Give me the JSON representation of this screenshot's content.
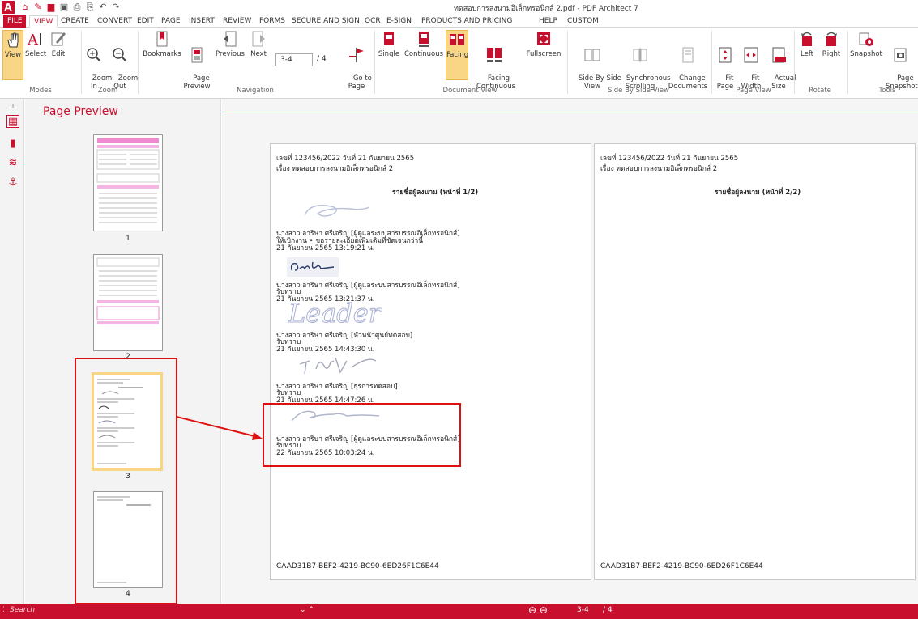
{
  "window": {
    "title": "ทดสอบการลงนามอิเล็กทรอนิกส์ 2.pdf   -   PDF Architect 7",
    "logo": "A"
  },
  "quick_access": [
    "home-icon",
    "pen-icon",
    "open-icon",
    "save-icon",
    "print-icon",
    "print-preview-icon",
    "undo-icon",
    "redo-icon"
  ],
  "tabs": [
    "FILE",
    "VIEW",
    "CREATE",
    "CONVERT",
    "EDIT",
    "PAGE",
    "INSERT",
    "REVIEW",
    "FORMS",
    "SECURE AND SIGN",
    "OCR",
    "E-SIGN",
    "PRODUCTS AND PRICING",
    "HELP",
    "CUSTOM"
  ],
  "active_tab": "VIEW",
  "ribbon": {
    "view": "View",
    "select": "Select",
    "edit": "Edit",
    "zoom_in": "Zoom\nIn",
    "zoom_out": "Zoom\nOut",
    "bookmarks": "Bookmarks",
    "page_preview": "Page\nPreview",
    "previous": "Previous",
    "next": "Next",
    "page_field": "3-4",
    "page_total": "/  4",
    "go_to_page": "Go to\nPage",
    "single": "Single",
    "continuous": "Continuous",
    "facing": "Facing",
    "facing_continuous": "Facing\nContinuous",
    "fullscreen": "Fullscreen",
    "side_by_side": "Side By Side\nView",
    "sync_scroll": "Synchronous\nScrolling",
    "change_docs": "Change\nDocuments",
    "fit_page": "Fit\nPage",
    "fit_width": "Fit\nWidth",
    "actual_size": "Actual\nSize",
    "left": "Left",
    "right": "Right",
    "snapshot": "Snapshot",
    "page_snapshot": "Page\nSnapshot",
    "groups": {
      "modes": "Modes",
      "zoom": "Zoom",
      "navigation": "Navigation",
      "document_view": "Document View",
      "side_by_side_view": "Side By Side View",
      "page_view": "Page View",
      "rotate": "Rotate",
      "tools": "Tools"
    }
  },
  "preview": {
    "title": "Page Preview",
    "pages": [
      "1",
      "2",
      "3",
      "4"
    ]
  },
  "doc": {
    "left_page": {
      "ref": "เลขที่ 123456/2022 วันที่ 21 กันยายน 2565",
      "subject": "เรื่อง ทดสอบการลงนามอิเล็กทรอนิกส์ 2",
      "heading": "รายชื่อผู้ลงนาม (หน้าที่ 1/2)",
      "signers": [
        {
          "name": "นางสาว อาริษา ศรีเจริญ [ผู้ดูแลระบบสารบรรณอิเล็กทรอนิกส์]",
          "note": "ให้เบิกงาน • ขอรายละเอียดเพิ่มเติมที่ชัดเจนกว่านี้",
          "date": "21 กันยายน 2565 13:19:21 น."
        },
        {
          "name": "นางสาว อาริษา ศรีเจริญ [ผู้ดูแลระบบสารบรรณอิเล็กทรอนิกส์]",
          "note": "รับทราบ",
          "date": "21 กันยายน 2565 13:21:37 น."
        },
        {
          "name": "นางสาว อาริษา ศรีเจริญ [หัวหน้าศูนย์ทดสอบ]",
          "note": "รับทราบ",
          "date": "21 กันยายน 2565 14:43:30 น."
        },
        {
          "name": "นางสาว อาริษา ศรีเจริญ [ธุรการทดสอบ]",
          "note": "รับทราบ",
          "date": "21 กันยายน 2565 14:47:26 น."
        },
        {
          "name": "นางสาว อาริษา ศรีเจริญ [ผู้ดูแลระบบสารบรรณอิเล็กทรอนิกส์]",
          "note": "รับทราบ",
          "date": "22 กันยายน 2565 10:03:24 น."
        }
      ],
      "signature_texts": [
        "Leader"
      ],
      "footer": "CAAD31B7-BEF2-4219-BC90-6ED26F1C6E44"
    },
    "right_page": {
      "ref": "เลขที่ 123456/2022 วันที่ 21 กันยายน 2565",
      "subject": "เรื่อง ทดสอบการลงนามอิเล็กทรอนิกส์ 2",
      "heading": "รายชื่อผู้ลงนาม (หน้าที่ 2/2)",
      "footer": "CAAD31B7-BEF2-4219-BC90-6ED26F1C6E44"
    }
  },
  "status": {
    "search": "Search",
    "page": "3-4",
    "total": "/ 4"
  },
  "colors": {
    "brand": "#c8102e",
    "active_button": "#f9d686",
    "annotation": "#e01010"
  }
}
